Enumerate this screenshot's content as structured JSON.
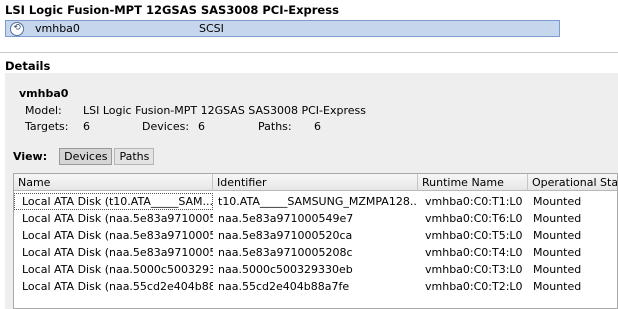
{
  "adapter": {
    "title": "LSI Logic Fusion-MPT 12GSAS SAS3008 PCI-Express",
    "icon": "hba-adapter-icon",
    "name": "vmhba0",
    "type": "SCSI"
  },
  "details": {
    "heading": "Details",
    "device_name": "vmhba0",
    "model_label": "Model:",
    "model_value": "LSI Logic Fusion-MPT 12GSAS SAS3008 PCI-Express",
    "targets_label": "Targets:",
    "targets_value": "6",
    "devices_label": "Devices:",
    "devices_value": "6",
    "paths_label": "Paths:",
    "paths_value": "6"
  },
  "view": {
    "label": "View:",
    "buttons": [
      "Devices",
      "Paths"
    ],
    "active": "Devices"
  },
  "table": {
    "columns": [
      "Name",
      "Identifier",
      "Runtime Name",
      "Operational State"
    ],
    "rows": [
      [
        "Local ATA Disk (t10.ATA_____SAM...",
        "t10.ATA_____SAMSUNG_MZMPA128...",
        "vmhba0:C0:T1:L0",
        "Mounted"
      ],
      [
        "Local ATA Disk (naa.5e83a9710005...",
        "naa.5e83a971000549e7",
        "vmhba0:C0:T6:L0",
        "Mounted"
      ],
      [
        "Local ATA Disk (naa.5e83a9710005...",
        "naa.5e83a971000520ca",
        "vmhba0:C0:T5:L0",
        "Mounted"
      ],
      [
        "Local ATA Disk (naa.5e83a9710005...",
        "naa.5e83a9710005208c",
        "vmhba0:C0:T4:L0",
        "Mounted"
      ],
      [
        "Local ATA Disk (naa.5000c5003293...",
        "naa.5000c500329330eb",
        "vmhba0:C0:T3:L0",
        "Mounted"
      ],
      [
        "Local ATA Disk (naa.55cd2e404b88...",
        "naa.55cd2e404b88a7fe",
        "vmhba0:C0:T2:L0",
        "Mounted"
      ]
    ]
  }
}
